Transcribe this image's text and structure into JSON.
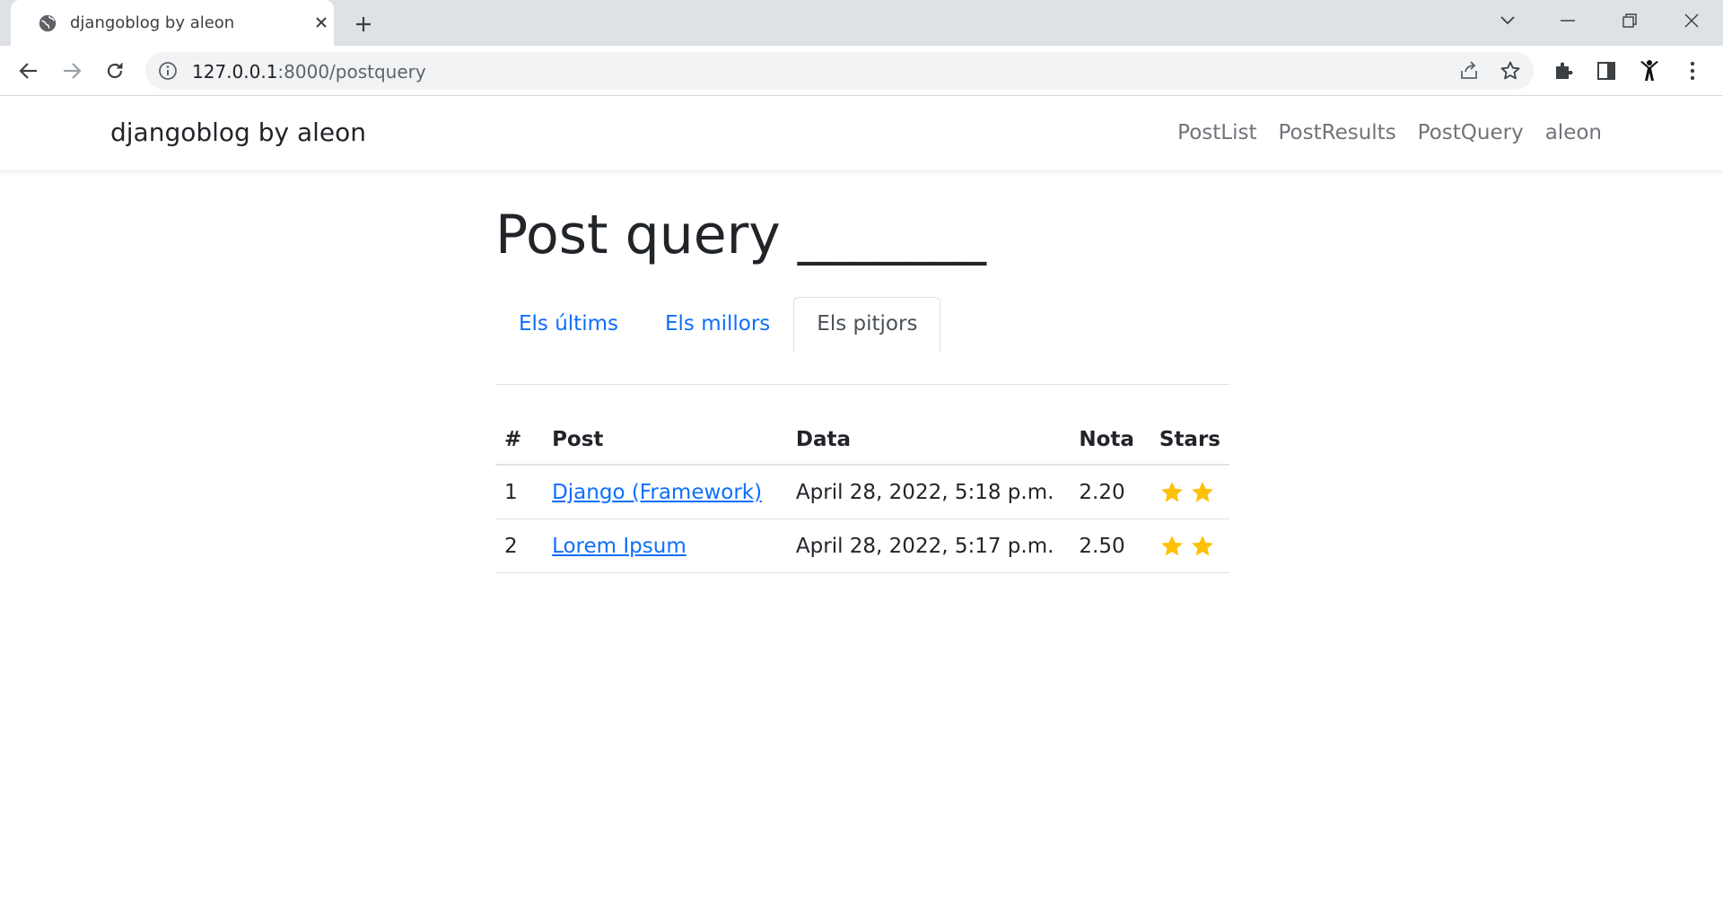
{
  "browser": {
    "tab_title": "djangoblog by aleon",
    "url_host": "127.0.0.1",
    "url_path": ":8000/postquery"
  },
  "navbar": {
    "brand": "djangoblog by aleon",
    "links": [
      "PostList",
      "PostResults",
      "PostQuery",
      "aleon"
    ]
  },
  "page": {
    "title": "Post query _______",
    "tabs": [
      {
        "label": "Els últims",
        "active": false
      },
      {
        "label": "Els millors",
        "active": false
      },
      {
        "label": "Els pitjors",
        "active": true
      }
    ]
  },
  "table": {
    "headers": [
      "#",
      "Post",
      "Data",
      "Nota",
      "Stars"
    ],
    "rows": [
      {
        "num": "1",
        "post": "Django (Framework)",
        "date": "April 28, 2022, 5:18 p.m.",
        "nota": "2.20",
        "stars": 2
      },
      {
        "num": "2",
        "post": "Lorem Ipsum",
        "date": "April 28, 2022, 5:17 p.m.",
        "nota": "2.50",
        "stars": 2
      }
    ]
  },
  "colors": {
    "link": "#0d6efd",
    "star": "#ffc107",
    "chrome_bg": "#dee1e6"
  }
}
